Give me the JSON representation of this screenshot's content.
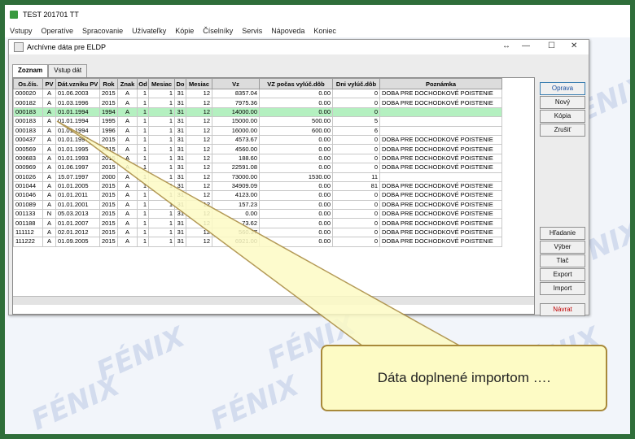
{
  "app": {
    "title": "TEST 201701 TT"
  },
  "menu": [
    "Vstupy",
    "Operatíve",
    "Spracovanie",
    "Užívateľky",
    "Kópie",
    "Číselníky",
    "Servis",
    "Nápoveda",
    "Koniec"
  ],
  "dialog": {
    "title": "Archívne dáta pre ELDP",
    "tabs": [
      "Zoznam",
      "Vstup dát"
    ],
    "buttons": {
      "oprava": "Oprava",
      "novy": "Nový",
      "kopia": "Kópia",
      "zrusit": "Zrušiť",
      "hladanie": "Hľadanie",
      "vyber": "Výber",
      "tlac": "Tlač",
      "export": "Export",
      "import": "Import",
      "navrat": "Návrat"
    }
  },
  "table": {
    "columns": [
      "Os.čís.",
      "PV",
      "Dát.vzniku PV",
      "Rok",
      "Znak",
      "Od",
      "Mesiac",
      "Do",
      "Mesiac",
      "Vz",
      "VZ počas vylúč.dôb",
      "Dni vylúč.dôb",
      "Poznámka"
    ],
    "rows": [
      [
        "000020",
        "A",
        "01.06.2003",
        "2015",
        "A",
        "1",
        "1",
        "31",
        "12",
        "8357.04",
        "0.00",
        "0",
        "DOBA PRE DOCHODKOVÉ POISTENIE"
      ],
      [
        "000182",
        "A",
        "01.03.1996",
        "2015",
        "A",
        "1",
        "1",
        "31",
        "12",
        "7975.36",
        "0.00",
        "0",
        "DOBA PRE DOCHODKOVÉ POISTENIE"
      ],
      [
        "000183",
        "A",
        "01.01.1994",
        "1994",
        "A",
        "1",
        "1",
        "31",
        "12",
        "14000.00",
        "0.00",
        "0",
        ""
      ],
      [
        "000183",
        "A",
        "01.01.1994",
        "1995",
        "A",
        "1",
        "1",
        "31",
        "12",
        "15000.00",
        "500.00",
        "5",
        ""
      ],
      [
        "000183",
        "A",
        "01.01.1994",
        "1996",
        "A",
        "1",
        "1",
        "31",
        "12",
        "16000.00",
        "600.00",
        "6",
        ""
      ],
      [
        "000437",
        "A",
        "01.01.1997",
        "2015",
        "A",
        "1",
        "1",
        "31",
        "12",
        "4573.67",
        "0.00",
        "0",
        "DOBA PRE DOCHODKOVÉ POISTENIE"
      ],
      [
        "000569",
        "A",
        "01.01.1995",
        "2015",
        "A",
        "1",
        "1",
        "31",
        "12",
        "4560.00",
        "0.00",
        "0",
        "DOBA PRE DOCHODKOVÉ POISTENIE"
      ],
      [
        "000683",
        "A",
        "01.01.1993",
        "2015",
        "A",
        "1",
        "1",
        "31",
        "12",
        "188.60",
        "0.00",
        "0",
        "DOBA PRE DOCHODKOVÉ POISTENIE"
      ],
      [
        "000969",
        "A",
        "01.06.1997",
        "2015",
        "A",
        "1",
        "1",
        "31",
        "12",
        "22591.08",
        "0.00",
        "0",
        "DOBA PRE DOCHODKOVÉ POISTENIE"
      ],
      [
        "001026",
        "A",
        "15.07.1997",
        "2000",
        "A",
        "1",
        "1",
        "31",
        "12",
        "73000.00",
        "1530.00",
        "11",
        ""
      ],
      [
        "001044",
        "A",
        "01.01.2005",
        "2015",
        "A",
        "1",
        "1",
        "31",
        "12",
        "34909.09",
        "0.00",
        "81",
        "DOBA PRE DOCHODKOVÉ POISTENIE"
      ],
      [
        "001046",
        "A",
        "01.01.2011",
        "2015",
        "A",
        "1",
        "1",
        "31",
        "12",
        "4123.00",
        "0.00",
        "0",
        "DOBA PRE DOCHODKOVÉ POISTENIE"
      ],
      [
        "001089",
        "A",
        "01.01.2001",
        "2015",
        "A",
        "1",
        "1",
        "31",
        "12",
        "157.23",
        "0.00",
        "0",
        "DOBA PRE DOCHODKOVÉ POISTENIE"
      ],
      [
        "001133",
        "N",
        "05.03.2013",
        "2015",
        "A",
        "1",
        "1",
        "31",
        "12",
        "0.00",
        "0.00",
        "0",
        "DOBA PRE DOCHODKOVÉ POISTENIE"
      ],
      [
        "001188",
        "A",
        "01.01.2007",
        "2015",
        "A",
        "1",
        "1",
        "31",
        "12",
        "73.62",
        "0.00",
        "0",
        "DOBA PRE DOCHODKOVÉ POISTENIE"
      ],
      [
        "111112",
        "A",
        "02.01.2012",
        "2015",
        "A",
        "1",
        "1",
        "31",
        "12",
        "560.37",
        "0.00",
        "0",
        "DOBA PRE DOCHODKOVÉ POISTENIE"
      ],
      [
        "111222",
        "A",
        "01.09.2005",
        "2015",
        "A",
        "1",
        "1",
        "31",
        "12",
        "6921.00",
        "0.00",
        "0",
        "DOBA PRE DOCHODKOVÉ POISTENIE"
      ]
    ],
    "selected_row": 2
  },
  "callout": {
    "text": "Dáta doplnené importom …."
  },
  "watermark": "FÉNIX"
}
